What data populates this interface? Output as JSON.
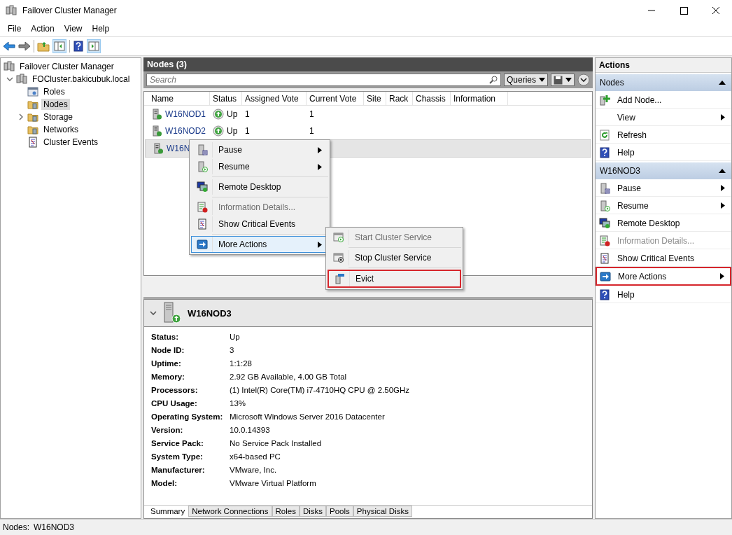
{
  "window": {
    "title": "Failover Cluster Manager"
  },
  "menu_bar": [
    "File",
    "Action",
    "View",
    "Help"
  ],
  "tree": {
    "items": [
      {
        "label": "Failover Cluster Manager",
        "selected": false,
        "children": [
          {
            "label": "FOCluster.bakicubuk.local",
            "selected": false,
            "expanded": true,
            "children": [
              {
                "label": "Roles",
                "selected": false
              },
              {
                "label": "Nodes",
                "selected": true
              },
              {
                "label": "Storage",
                "selected": false,
                "expanded": false
              },
              {
                "label": "Networks",
                "selected": false
              },
              {
                "label": "Cluster Events",
                "selected": false
              }
            ]
          }
        ]
      }
    ]
  },
  "nodes_panel": {
    "title": "Nodes (3)",
    "search": {
      "placeholder": "Search"
    },
    "queries_button": "Queries",
    "table": {
      "columns": [
        "Name",
        "Status",
        "Assigned Vote",
        "Current Vote",
        "Site",
        "Rack",
        "Chassis",
        "Information"
      ],
      "rows": [
        {
          "name": "W16NOD1",
          "status": "Up",
          "assigned_vote": "1",
          "current_vote": "1",
          "selected": false
        },
        {
          "name": "W16NOD2",
          "status": "Up",
          "assigned_vote": "1",
          "current_vote": "1",
          "selected": false
        },
        {
          "name": "W16N",
          "selected": true
        }
      ]
    }
  },
  "context_menu": {
    "groups": [
      [
        {
          "label": "Pause",
          "submenu": true,
          "disabled": false,
          "selected": false
        },
        {
          "label": "Resume",
          "submenu": true,
          "disabled": false,
          "selected": false
        }
      ],
      [
        {
          "label": "Remote Desktop",
          "submenu": false,
          "disabled": false,
          "selected": false
        }
      ],
      [
        {
          "label": "Information Details...",
          "submenu": false,
          "disabled": true,
          "selected": false
        },
        {
          "label": "Show Critical Events",
          "submenu": false,
          "disabled": false,
          "selected": false
        }
      ],
      [
        {
          "label": "More Actions",
          "submenu": true,
          "disabled": false,
          "selected": true
        }
      ]
    ]
  },
  "submenu": {
    "groups": [
      [
        {
          "label": "Start Cluster Service",
          "disabled": true,
          "outlined": false
        }
      ],
      [
        {
          "label": "Stop Cluster Service",
          "disabled": false,
          "outlined": false
        }
      ],
      [
        {
          "label": "Evict",
          "disabled": false,
          "outlined": true
        }
      ]
    ]
  },
  "details": {
    "title": "W16NOD3",
    "properties": [
      {
        "label": "Status:",
        "value": "Up"
      },
      {
        "label": "Node ID:",
        "value": "3"
      },
      {
        "label": "Uptime:",
        "value": "1:1:28"
      },
      {
        "label": "Memory:",
        "value": "2.92 GB Available, 4.00 GB Total"
      },
      {
        "label": "Processors:",
        "value": "(1) Intel(R) Core(TM) i7-4710HQ CPU @ 2.50GHz"
      },
      {
        "label": "CPU Usage:",
        "value": "13%"
      },
      {
        "label": "Operating System:",
        "value": "Microsoft Windows Server 2016 Datacenter"
      },
      {
        "label": "Version:",
        "value": "10.0.14393"
      },
      {
        "label": "Service Pack:",
        "value": "No Service Pack Installed"
      },
      {
        "label": "System Type:",
        "value": "x64-based PC"
      },
      {
        "label": "Manufacturer:",
        "value": "VMware, Inc."
      },
      {
        "label": "Model:",
        "value": "VMware Virtual Platform"
      }
    ],
    "tabs": [
      {
        "label": "Summary",
        "selected": true
      },
      {
        "label": "Network Connections",
        "selected": false
      },
      {
        "label": "Roles",
        "selected": false
      },
      {
        "label": "Disks",
        "selected": false
      },
      {
        "label": "Pools",
        "selected": false
      },
      {
        "label": "Physical Disks",
        "selected": false
      }
    ]
  },
  "actions": {
    "title": "Actions",
    "sections": [
      {
        "title": "Nodes",
        "items": [
          {
            "label": "Add Node...",
            "submenu": false,
            "disabled": false,
            "outlined": false
          },
          {
            "label": "View",
            "submenu": true,
            "disabled": false,
            "outlined": false
          },
          {
            "label": "Refresh",
            "submenu": false,
            "disabled": false,
            "outlined": false
          },
          {
            "label": "Help",
            "submenu": false,
            "disabled": false,
            "outlined": false
          }
        ]
      },
      {
        "title": "W16NOD3",
        "items": [
          {
            "label": "Pause",
            "submenu": true,
            "disabled": false,
            "outlined": false
          },
          {
            "label": "Resume",
            "submenu": true,
            "disabled": false,
            "outlined": false
          },
          {
            "label": "Remote Desktop",
            "submenu": false,
            "disabled": false,
            "outlined": false
          },
          {
            "label": "Information Details...",
            "submenu": false,
            "disabled": true,
            "outlined": false
          },
          {
            "label": "Show Critical Events",
            "submenu": false,
            "disabled": false,
            "outlined": false
          },
          {
            "label": "More Actions",
            "submenu": true,
            "disabled": false,
            "outlined": true
          },
          {
            "label": "Help",
            "submenu": false,
            "disabled": false,
            "outlined": false
          }
        ]
      }
    ]
  },
  "status_bar": {
    "label": "Nodes:",
    "value": "W16NOD3"
  }
}
